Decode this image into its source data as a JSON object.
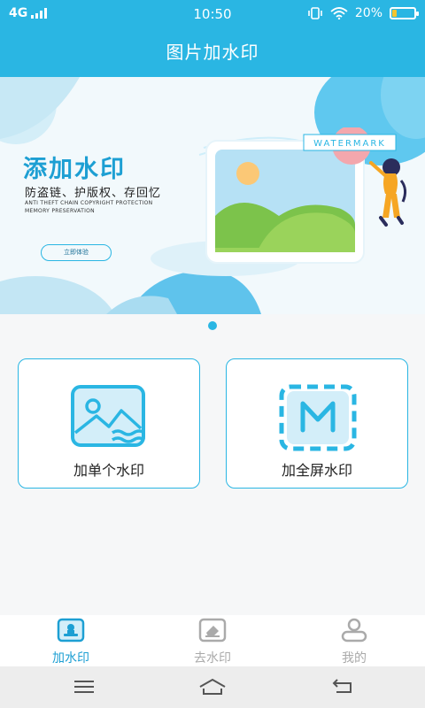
{
  "status_bar": {
    "network": "4G",
    "time": "10:50",
    "battery": "20%",
    "battery_level": 0.2
  },
  "header": {
    "title": "图片加水印"
  },
  "banner": {
    "title": "添加水印",
    "subtitle": "防盗链、护版权、存回忆",
    "english_line1": "ANTI THEFT CHAIN  COPYRIGHT PROTECTION",
    "english_line2": "MEMORY PRESERVATION",
    "button_label": "立即体验",
    "watermark_label": "WATERMARK",
    "page_indicator": {
      "total": 1,
      "active": 1
    }
  },
  "cards": [
    {
      "label": "加单个水印",
      "icon": "image-icon"
    },
    {
      "label": "加全屏水印",
      "icon": "m-frame-icon"
    }
  ],
  "tabbar": {
    "items": [
      {
        "label": "加水印",
        "icon": "stamp-icon",
        "active": true
      },
      {
        "label": "去水印",
        "icon": "eraser-icon",
        "active": false
      },
      {
        "label": "我的",
        "icon": "user-icon",
        "active": false
      }
    ]
  },
  "navbar": {
    "items": [
      "menu-icon",
      "home-icon",
      "back-icon"
    ]
  },
  "colors": {
    "accent": "#2ab6e3",
    "active_tab": "#1d9fd3",
    "inactive_tab": "#aaaaaa",
    "battery": "#f4c430"
  }
}
